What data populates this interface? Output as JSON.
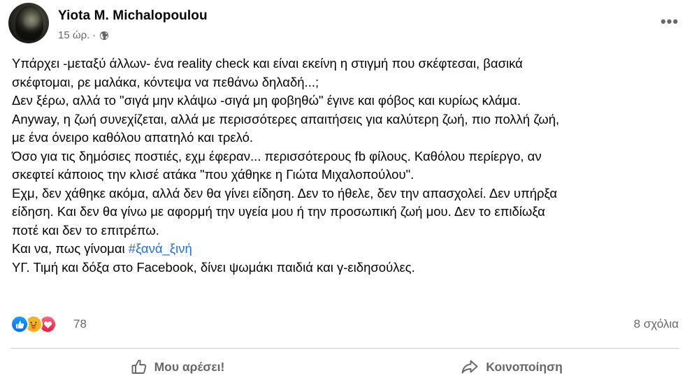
{
  "post": {
    "author": "Yiota M. Michalopoulou",
    "time": "15 ώρ.",
    "separator": "·",
    "privacy_icon": "globe-icon",
    "more_icon": "more-options-icon",
    "more_label": "•••",
    "text_lines": [
      "Υπάρχει -μεταξύ άλλων- ένα reality check και είναι εκείνη η στιγμή που σκέφτεσαι, βασικά",
      "σκέφτομαι, ρε μαλάκα, κόντεψα να πεθάνω δηλαδή...;",
      "Δεν ξέρω, αλλά το \"σιγά μην κλάψω -σιγά μη φοβηθώ\" έγινε και φόβος και κυρίως κλάμα.",
      "Anyway, η ζωή συνεχίζεται, αλλά με περισσότερες απαιτήσεις για καλύτερη ζωή, πιο πολλή ζωή,",
      "με ένα όνειρο καθόλου απατηλό και τρελό.",
      "Όσο για τις δημόσιες ποστιές, εχμ έφεραν... περισσότερους fb φίλους. Καθόλου περίεργο, αν",
      "σκεφτεί κάποιος την κλισέ ατάκα \"που χάθηκε η Γιώτα Μιχαλοπούλου\".",
      "Εχμ, δεν χάθηκε ακόμα, αλλά δεν θα γίνει είδηση. Δεν το ήθελε, δεν την απασχολεί. Δεν υπήρξα",
      "είδηση. Και δεν θα γίνω με αφορμή την υγεία μου ή την προσωπική ζωή μου. Δεν το επιδίωξα",
      "ποτέ και δεν το επιτρέπω."
    ],
    "hashtag_line_prefix": "Και να, πως γίνομαι ",
    "hashtag": "#ξανά_ξινή",
    "last_line": "ΥΓ. Τιμή και δόξα στο Facebook, δίνει ψωμάκι παιδιά και γ-ειδησούλες.",
    "reactions": {
      "icons": [
        "like-icon",
        "care-icon",
        "love-icon"
      ],
      "count": "78",
      "comments": "8 σχόλια"
    },
    "actions": {
      "like_label": "Μου αρέσει!",
      "share_label": "Κοινοποίηση"
    },
    "colors": {
      "text": "#050505",
      "secondary": "#65676b",
      "hashtag": "#216fdb",
      "like_blue": "#0866ff",
      "love_red": "#e61e41",
      "care_yellow": "#f7b125"
    }
  }
}
